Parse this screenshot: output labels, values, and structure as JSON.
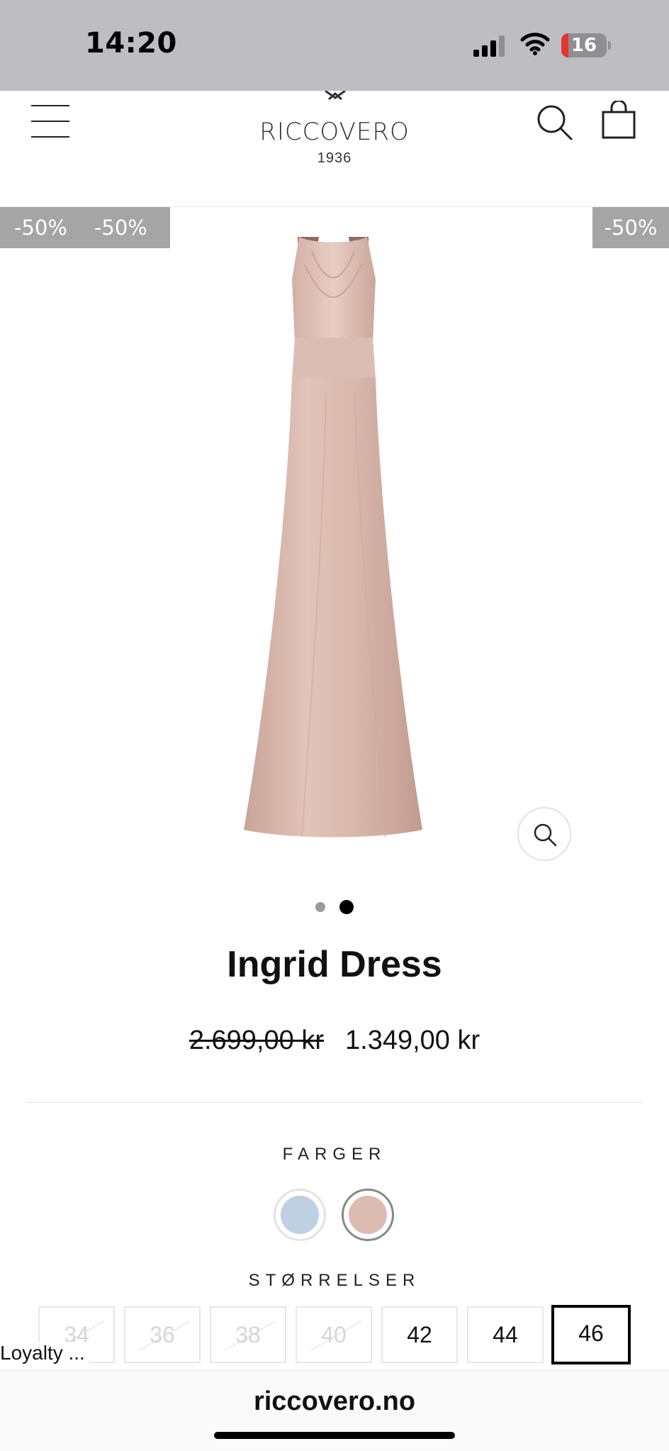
{
  "status_bar": {
    "time": "14:20",
    "battery_level": "16",
    "battery_fraction": 0.16,
    "icons": [
      "signal-icon",
      "wifi-icon",
      "battery-icon"
    ]
  },
  "header": {
    "logo_name": "RICCOVERO",
    "logo_year": "1936",
    "icons": [
      "menu-icon",
      "search-icon",
      "shopping-bag-icon"
    ]
  },
  "gallery": {
    "badges_left": [
      "-50%",
      "-50%"
    ],
    "badge_right": "-50%",
    "image_count": 2,
    "active_index": 2,
    "zoom_icon": "zoom-icon"
  },
  "product": {
    "title": "Ingrid Dress",
    "price_original": "2.699,00 kr",
    "price_sale": "1.349,00 kr",
    "dress_color": "#d9b8ae"
  },
  "colors": {
    "label": "FARGER",
    "swatches": [
      {
        "color": "#bfd0e3",
        "selected": false
      },
      {
        "color": "#dcbcb1",
        "selected": true
      }
    ]
  },
  "sizes": {
    "label": "STØRRELSER",
    "options": [
      {
        "label": "34",
        "available": false
      },
      {
        "label": "36",
        "available": false
      },
      {
        "label": "38",
        "available": false
      },
      {
        "label": "40",
        "available": false
      },
      {
        "label": "42",
        "available": true
      },
      {
        "label": "44",
        "available": true
      },
      {
        "label": "46",
        "available": true,
        "selected": true
      }
    ]
  },
  "loyalty": {
    "label": "Loyalty ..."
  },
  "browser": {
    "url": "riccovero.no"
  }
}
